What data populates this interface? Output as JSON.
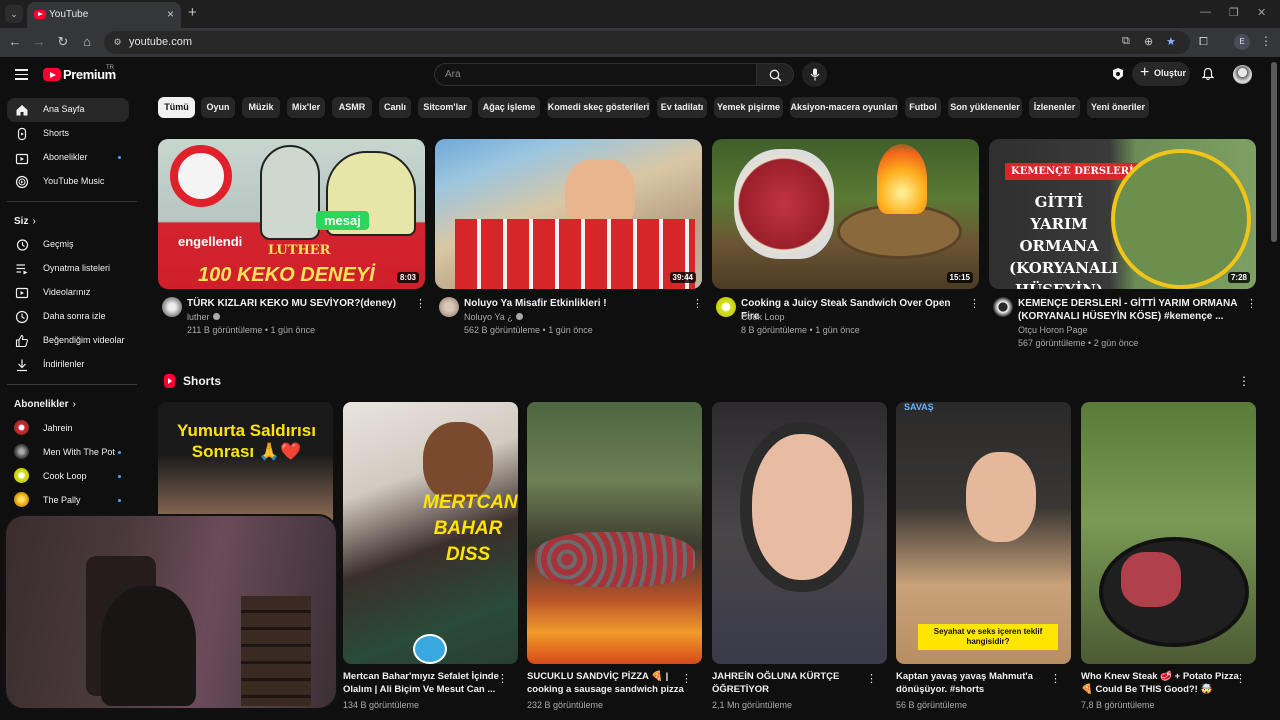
{
  "browser": {
    "tab_title": "YouTube",
    "url": "youtube.com",
    "profile_initial": "E"
  },
  "masthead": {
    "logo_text": "Premium",
    "country_code": "TR",
    "search_placeholder": "Ara",
    "create_label": "Oluştur"
  },
  "sidebar": {
    "main_items": [
      {
        "label": "Ana Sayfa",
        "icon": "home-icon"
      },
      {
        "label": "Shorts",
        "icon": "shorts-icon"
      },
      {
        "label": "Abonelikler",
        "icon": "subscriptions-icon"
      },
      {
        "label": "YouTube Music",
        "icon": "youtube-music-icon"
      }
    ],
    "you_heading": "Siz",
    "you_items": [
      {
        "label": "Geçmiş",
        "icon": "history-icon"
      },
      {
        "label": "Oynatma listeleri",
        "icon": "playlists-icon"
      },
      {
        "label": "Videolarınız",
        "icon": "your-videos-icon"
      },
      {
        "label": "Daha sonra izle",
        "icon": "watch-later-icon"
      },
      {
        "label": "Beğendiğim videolar",
        "icon": "liked-videos-icon"
      },
      {
        "label": "İndirilenler",
        "icon": "downloads-icon"
      }
    ],
    "subs_heading": "Abonelikler",
    "subscriptions": [
      {
        "label": "Jahrein"
      },
      {
        "label": "Men With The Pot"
      },
      {
        "label": "Cook Loop"
      },
      {
        "label": "The Pally"
      }
    ]
  },
  "chips": [
    "Tümü",
    "Oyun",
    "Müzik",
    "Mix'ler",
    "ASMR",
    "Canlı",
    "Sitcom'lar",
    "Ağaç işleme",
    "Komedi skeç gösterileri",
    "Ev tadilatı",
    "Yemek pişirme",
    "Aksiyon-macera oyunları",
    "Futbol",
    "Son yüklenenler",
    "İzlenenler",
    "Yeni öneriler"
  ],
  "videos": [
    {
      "title": "TÜRK KIZLARI KEKO MU SEVİYOR?(deney)",
      "channel": "luther",
      "meta": "211 B görüntüleme • 1 gün önce",
      "duration": "8:03",
      "thumb_text_1": "engellendi",
      "thumb_text_2": "LUTHER",
      "thumb_text_3": "mesaj",
      "thumb_text_4": "100 KEKO DENEYİ"
    },
    {
      "title": "Noluyo Ya Misafir Etkinlikleri !",
      "channel": "Noluyo Ya ¿",
      "meta": "562 B görüntüleme • 1 gün önce",
      "duration": "39:44"
    },
    {
      "title": "Cooking a Juicy Steak Sandwich Over Open Fire",
      "channel": "Cook Loop",
      "meta": "8 B görüntüleme • 1 gün önce",
      "duration": "15:15"
    },
    {
      "title": "KEMENÇE DERSLERİ - GİTTİ YARIM ORMANA (KORYANALI HÜSEYİN KÖSE) #kemençe ...",
      "channel": "Otçu Horon Page",
      "meta": "567 görüntüleme • 2 gün önce",
      "duration": "7:28",
      "thumb_text_1": "KEMENÇE DERSLERİ",
      "thumb_text_2": "GİTTİ YARIM ORMANA (KORYANALI HÜSEYİN)"
    }
  ],
  "shorts": {
    "heading": "Shorts",
    "items": [
      {
        "title": "",
        "meta": "",
        "overlay": "Yumurta Saldırısı Sonrası 🙏❤️"
      },
      {
        "title": "Mertcan Bahar'mıyız Sefalet İçinde Olalım | Ali Biçim Ve Mesut Can ...",
        "meta": "134 B görüntüleme",
        "overlay": "MERTCAN BAHAR DISS"
      },
      {
        "title": "SUCUKLU SANDVİÇ PİZZA 🍕 | cooking a sausage sandwich pizza",
        "meta": "232 B görüntüleme"
      },
      {
        "title": "JAHREİN OĞLUNA KÜRTÇE ÖĞRETİYOR",
        "meta": "2,1 Mn görüntüleme"
      },
      {
        "title": "Kaptan yavaş yavaş Mahmut'a dönüşüyor. #shorts",
        "meta": "56 B görüntüleme",
        "overlay": "Seyahat ve seks içeren teklif hangisidir?",
        "badge": "SAVAŞ"
      },
      {
        "title": "Who Knew Steak 🥩 + Potato Pizza 🍕 Could Be THIS Good?! 🤯",
        "meta": "7,8 B görüntüleme"
      }
    ]
  },
  "colors": {
    "background": "#0f0f0f",
    "brand_red": "#ff0033",
    "chip_bg": "#272727",
    "secondary_text": "#aaaaaa"
  }
}
